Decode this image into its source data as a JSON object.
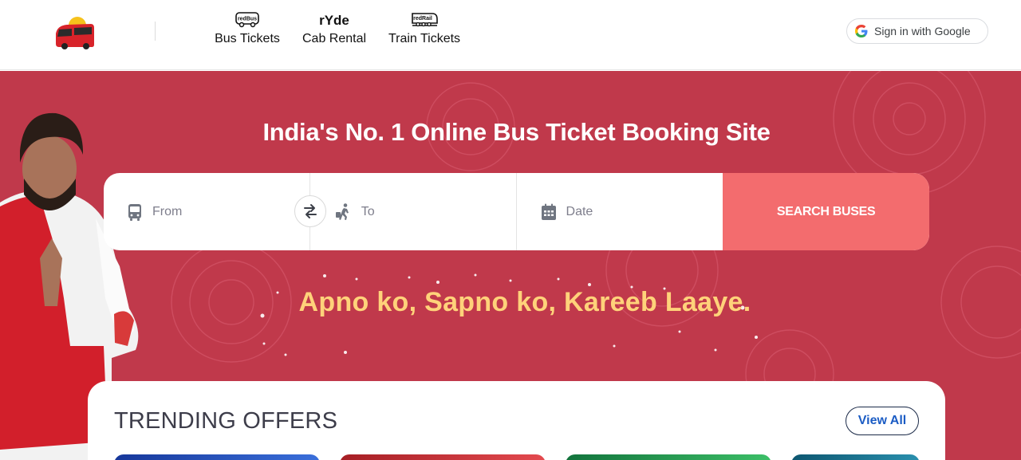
{
  "header": {
    "nav": [
      {
        "brand": "redBus",
        "label": "Bus Tickets",
        "icon": "bus-outline-icon"
      },
      {
        "brand": "rYde",
        "label": "Cab Rental",
        "icon": "ryde-logo-icon"
      },
      {
        "brand": "redRail",
        "label": "Train Tickets",
        "icon": "train-outline-icon"
      }
    ],
    "signin_label": "Sign in with Google"
  },
  "hero": {
    "title": "India's No. 1 Online Bus Ticket Booking Site",
    "tagline": "Apno ko, Sapno ko, Kareeb Laaye.",
    "background_color": "#c0394b",
    "tagline_color": "#ffd27a"
  },
  "search": {
    "from_placeholder": "From",
    "to_placeholder": "To",
    "date_placeholder": "Date",
    "button_label": "SEARCH BUSES",
    "button_color": "#f36c6e"
  },
  "trending": {
    "title": "TRENDING OFFERS",
    "view_all_label": "View All"
  }
}
